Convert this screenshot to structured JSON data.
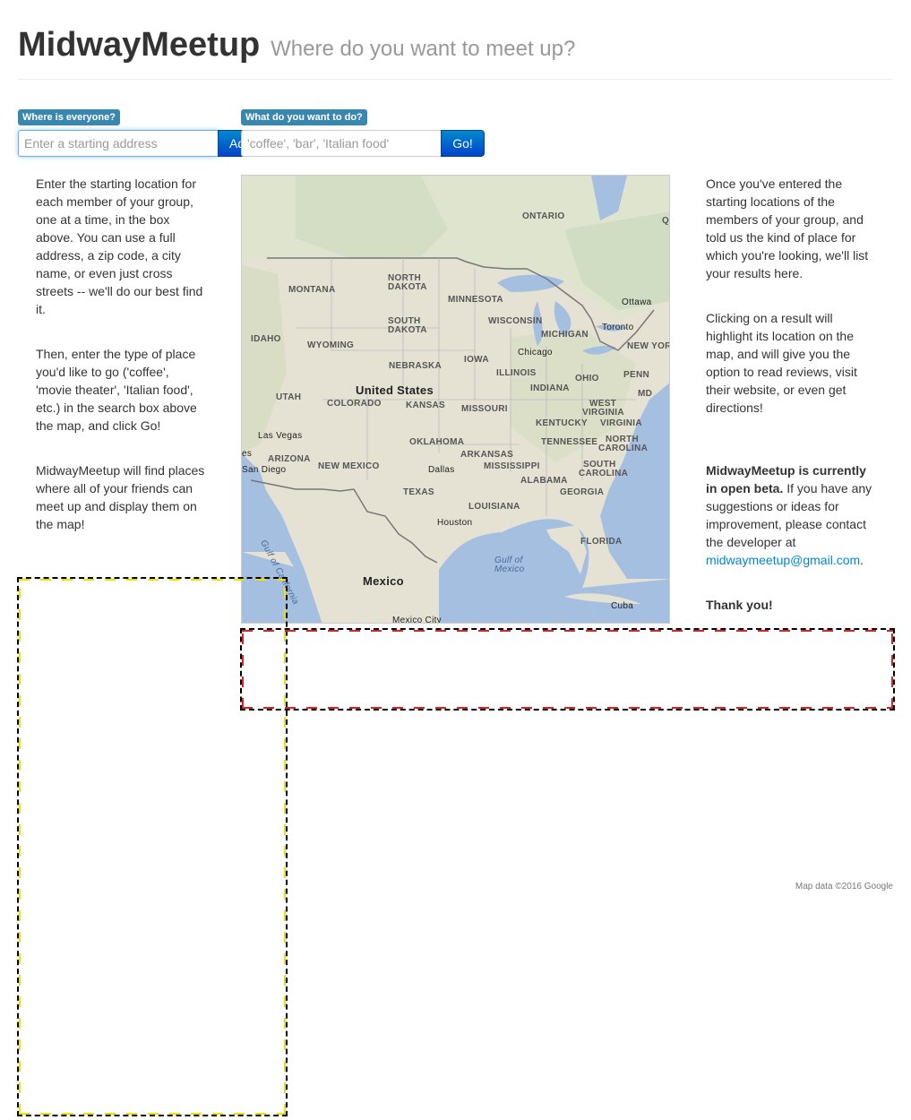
{
  "header": {
    "title": "MidwayMeetup",
    "tagline": "Where do you want to meet up?"
  },
  "search": {
    "where_label": "Where is everyone?",
    "address_placeholder": "Enter a starting address",
    "add_button": "Add",
    "what_label": "What do you want to do?",
    "query_placeholder": "'coffee', 'bar', 'Italian food'",
    "go_button": "Go!"
  },
  "left_column": {
    "p1": "Enter the starting location for each member of your group, one at a time, in the box above. You can use a full address, a zip code, a city name, or even just cross streets -- we'll do our best find it.",
    "p2": "Then, enter the type of place you'd like to go ('coffee', 'movie theater', 'Italian food', etc.) in the search box above the map, and click Go!",
    "p3": "MidwayMeetup will find places where all of your friends can meet up and display them on the map!"
  },
  "right_column": {
    "p1": "Once you've entered the starting locations of the members of your group, and told us the kind of place for which you're looking, we'll list your results here.",
    "p2": "Clicking on a result will highlight its location on the map, and will give you the option to read reviews, visit their website, or even get directions!",
    "beta_strong": "MidwayMeetup is currently in open beta.",
    "beta_rest": " If you have any suggestions or ideas for improvement, please contact the developer at",
    "email": "midwaymeetup@gmail.com",
    "period": ".",
    "thanks": "Thank you!"
  },
  "map": {
    "labels": {
      "ontario": "ONTARIO",
      "q": "Q",
      "north_dakota_1": "NORTH",
      "north_dakota_2": "DAKOTA",
      "montana": "MONTANA",
      "minnesota": "MINNESOTA",
      "ottawa": "Ottawa",
      "south_dakota_1": "SOUTH",
      "south_dakota_2": "DAKOTA",
      "wisconsin": "WISCONSIN",
      "toronto": "Toronto",
      "idaho": "IDAHO",
      "wyoming": "WYOMING",
      "michigan": "MICHIGAN",
      "new_york": "NEW YOR",
      "chicago": "Chicago",
      "nebraska": "NEBRASKA",
      "iowa": "IOWA",
      "illinois": "ILLINOIS",
      "penn": "PENN",
      "ohio": "OHIO",
      "united_states": "United States",
      "utah": "UTAH",
      "indiana": "INDIANA",
      "md": "MD",
      "colorado": "COLORADO",
      "kansas": "KANSAS",
      "missouri": "MISSOURI",
      "west_virginia_1": "WEST",
      "west_virginia_2": "VIRGINIA",
      "kentucky": "KENTUCKY",
      "virginia": "VIRGINIA",
      "las_vegas": "Las Vegas",
      "tennessee": "TENNESSEE",
      "north_carolina_1": "NORTH",
      "north_carolina_2": "CAROLINA",
      "oklahoma": "OKLAHOMA",
      "arizona": "ARIZONA",
      "arkansas": "ARKANSAS",
      "es": "es",
      "san_diego": "San Diego",
      "new_mexico": "NEW MEXICO",
      "dallas": "Dallas",
      "mississippi": "MISSISSIPPI",
      "south_carolina_1": "SOUTH",
      "south_carolina_2": "CAROLINA",
      "alabama": "ALABAMA",
      "georgia": "GEORGIA",
      "texas": "TEXAS",
      "louisiana": "LOUISIANA",
      "houston": "Houston",
      "gulf_california": "Gulf of California",
      "florida": "FLORIDA",
      "gulf_mexico_1": "Gulf of",
      "gulf_mexico_2": "Mexico",
      "mexico": "Mexico",
      "cuba": "Cuba",
      "mexico_city": "Mexico City"
    }
  },
  "attribution": "Map data ©2016 Google"
}
